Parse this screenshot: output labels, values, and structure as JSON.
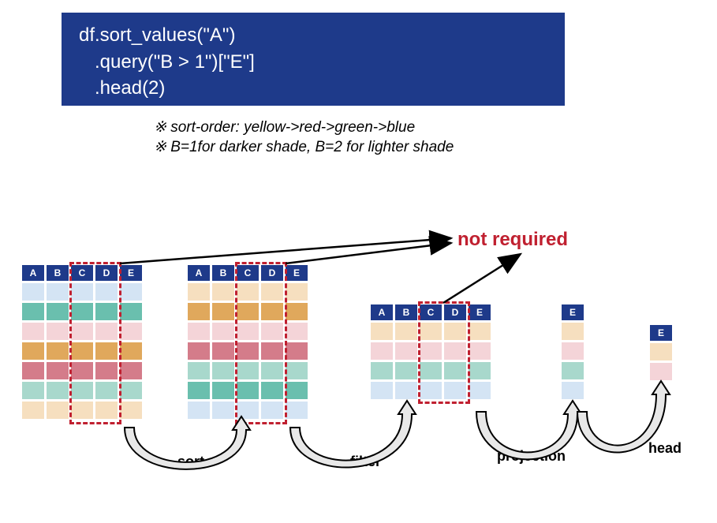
{
  "code": {
    "line1": "df.sort_values(\"A\")",
    "line2": "   .query(\"B > 1\")[\"E\"]",
    "line3": "   .head(2)"
  },
  "notes": {
    "line1": "※ sort-order: yellow->red->green->blue",
    "line2": "※ B=1for darker shade, B=2 for lighter shade"
  },
  "not_required_label": "not required",
  "ops": {
    "sort": "sort",
    "filter": "filter",
    "projection": "projection",
    "head": "head"
  },
  "columns": [
    "A",
    "B",
    "C",
    "D",
    "E"
  ],
  "colors": {
    "header": "#1e3a8a",
    "blue_light": "#d0e0f0",
    "blue_dark": "#5aa9a0",
    "teal_dark": "#5aa9a0",
    "teal_light": "#a8d8cc",
    "pink_light": "#f4d4d8",
    "pink_dark": "#d47c8a",
    "orange_light": "#f6dfbf",
    "orange_dark": "#e0a85c",
    "yellow_light": "#f6dfbf"
  },
  "tables": {
    "t1": {
      "cols": [
        "A",
        "B",
        "C",
        "D",
        "E"
      ],
      "rows": [
        [
          "#d4e4f4",
          "#d4e4f4",
          "#d4e4f4",
          "#d4e4f4",
          "#d4e4f4"
        ],
        [
          "#6abfae",
          "#6abfae",
          "#6abfae",
          "#6abfae",
          "#6abfae"
        ],
        [
          "#f4d4d8",
          "#f4d4d8",
          "#f4d4d8",
          "#f4d4d8",
          "#f4d4d8"
        ],
        [
          "#e0a85c",
          "#e0a85c",
          "#e0a85c",
          "#e0a85c",
          "#e0a85c"
        ],
        [
          "#d47c8a",
          "#d47c8a",
          "#d47c8a",
          "#d47c8a",
          "#d47c8a"
        ],
        [
          "#a8d8cc",
          "#a8d8cc",
          "#a8d8cc",
          "#a8d8cc",
          "#a8d8cc"
        ],
        [
          "#f6dfbf",
          "#f6dfbf",
          "#f6dfbf",
          "#f6dfbf",
          "#f6dfbf"
        ]
      ]
    },
    "t2": {
      "cols": [
        "A",
        "B",
        "C",
        "D",
        "E"
      ],
      "rows": [
        [
          "#f6dfbf",
          "#f6dfbf",
          "#f6dfbf",
          "#f6dfbf",
          "#f6dfbf"
        ],
        [
          "#e0a85c",
          "#e0a85c",
          "#e0a85c",
          "#e0a85c",
          "#e0a85c"
        ],
        [
          "#f4d4d8",
          "#f4d4d8",
          "#f4d4d8",
          "#f4d4d8",
          "#f4d4d8"
        ],
        [
          "#d47c8a",
          "#d47c8a",
          "#d47c8a",
          "#d47c8a",
          "#d47c8a"
        ],
        [
          "#a8d8cc",
          "#a8d8cc",
          "#a8d8cc",
          "#a8d8cc",
          "#a8d8cc"
        ],
        [
          "#6abfae",
          "#6abfae",
          "#6abfae",
          "#6abfae",
          "#6abfae"
        ],
        [
          "#d4e4f4",
          "#d4e4f4",
          "#d4e4f4",
          "#d4e4f4",
          "#d4e4f4"
        ]
      ]
    },
    "t3": {
      "cols": [
        "A",
        "B",
        "C",
        "D",
        "E"
      ],
      "rows": [
        [
          "#f6dfbf",
          "#f6dfbf",
          "#f6dfbf",
          "#f6dfbf",
          "#f6dfbf"
        ],
        [
          "#f4d4d8",
          "#f4d4d8",
          "#f4d4d8",
          "#f4d4d8",
          "#f4d4d8"
        ],
        [
          "#a8d8cc",
          "#a8d8cc",
          "#a8d8cc",
          "#a8d8cc",
          "#a8d8cc"
        ],
        [
          "#d4e4f4",
          "#d4e4f4",
          "#d4e4f4",
          "#d4e4f4",
          "#d4e4f4"
        ]
      ]
    },
    "t4": {
      "cols": [
        "E"
      ],
      "rows": [
        [
          "#f6dfbf"
        ],
        [
          "#f4d4d8"
        ],
        [
          "#a8d8cc"
        ],
        [
          "#d4e4f4"
        ]
      ]
    },
    "t5": {
      "cols": [
        "E"
      ],
      "rows": [
        [
          "#f6dfbf"
        ],
        [
          "#f4d4d8"
        ]
      ]
    }
  }
}
